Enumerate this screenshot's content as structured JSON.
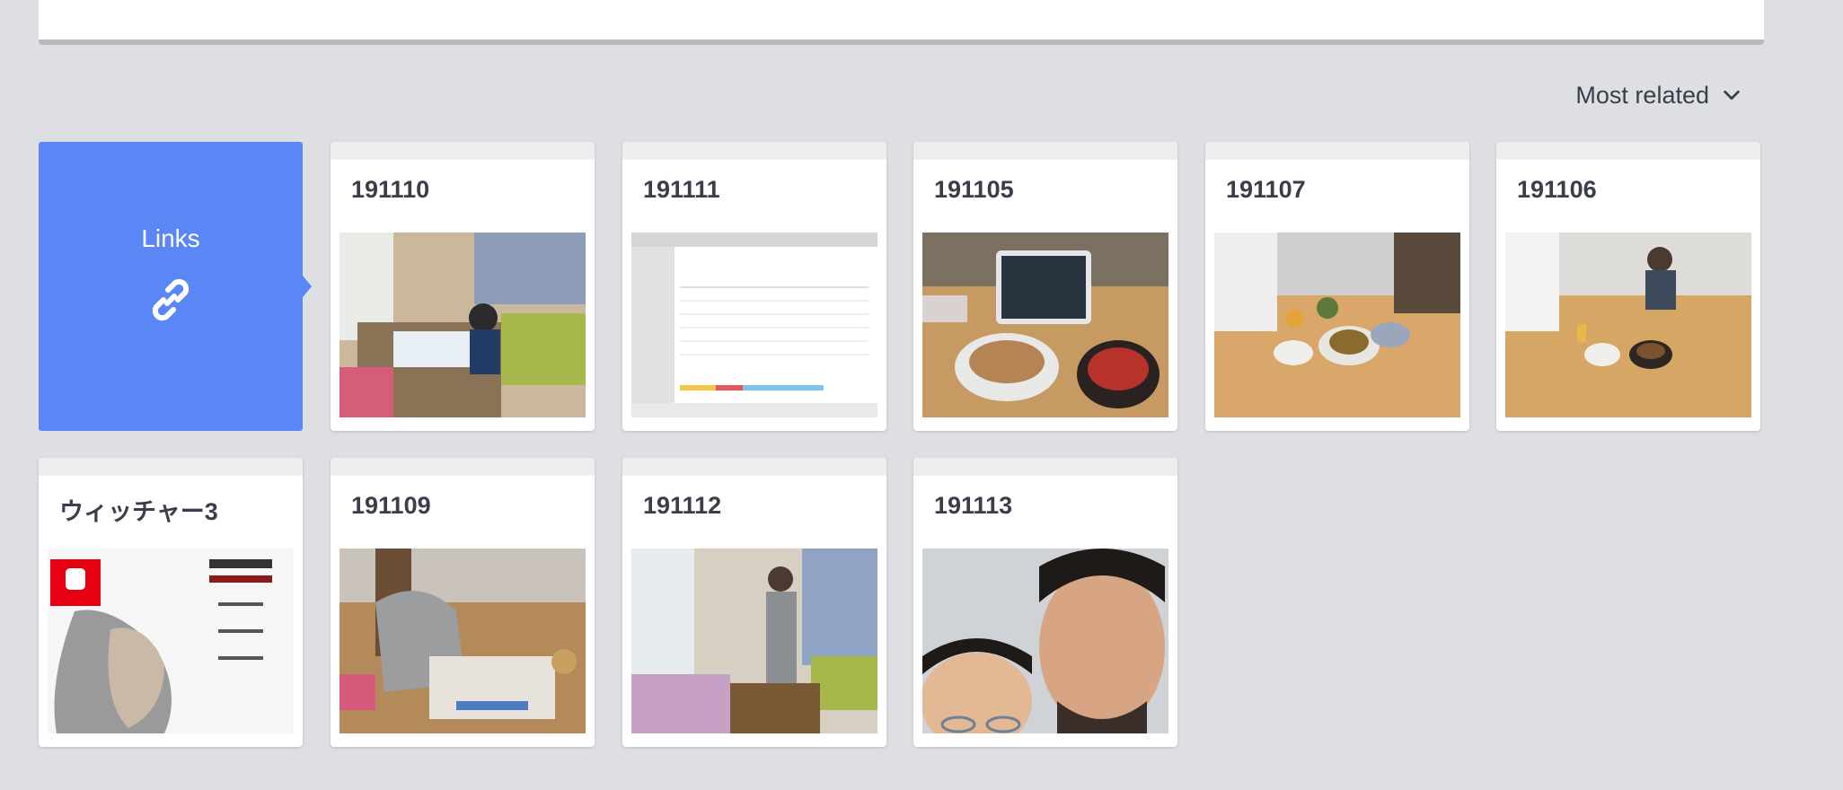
{
  "sort": {
    "label": "Most related",
    "icon": "chevron-down-icon"
  },
  "links_card": {
    "label": "Links",
    "icon": "link-icon",
    "color": "#5b86f5"
  },
  "items": [
    {
      "title": "191110"
    },
    {
      "title": "191111"
    },
    {
      "title": "191105"
    },
    {
      "title": "191107"
    },
    {
      "title": "191106"
    },
    {
      "title": "ウィッチャー3"
    },
    {
      "title": "191109"
    },
    {
      "title": "191112"
    },
    {
      "title": "191113"
    }
  ],
  "colors": {
    "background": "#dedfe3",
    "card": "#ffffff",
    "text": "#3a3e4a"
  }
}
